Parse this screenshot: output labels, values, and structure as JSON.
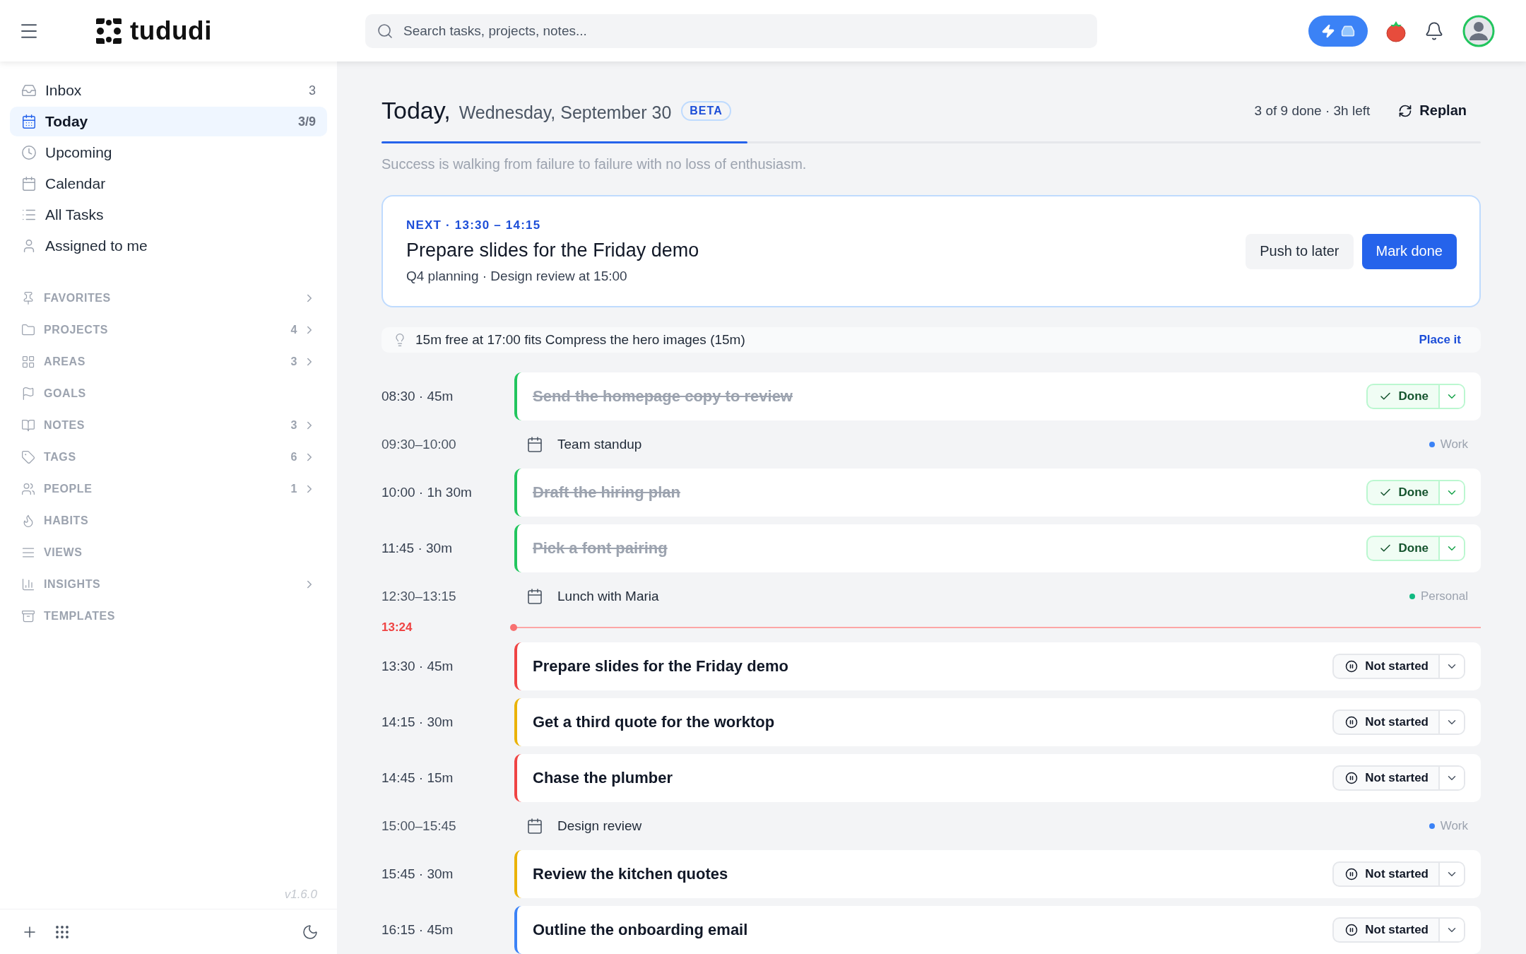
{
  "header": {
    "app_name": "tududi",
    "search": {
      "placeholder": "Search tasks, projects, notes..."
    }
  },
  "sidebar": {
    "nav": [
      {
        "label": "Inbox",
        "count": "3",
        "selected": false
      },
      {
        "label": "Today",
        "count": "3/9",
        "selected": true
      },
      {
        "label": "Upcoming",
        "selected": false
      },
      {
        "label": "Calendar",
        "selected": false
      },
      {
        "label": "All Tasks",
        "selected": false
      },
      {
        "label": "Assigned to me",
        "selected": false
      }
    ],
    "sections": [
      {
        "label": "FAVORITES",
        "expandable": true
      },
      {
        "label": "PROJECTS",
        "count": "4",
        "expandable": true
      },
      {
        "label": "AREAS",
        "count": "3",
        "expandable": true
      },
      {
        "label": "GOALS",
        "expandable": false
      },
      {
        "label": "NOTES",
        "count": "3",
        "expandable": true
      },
      {
        "label": "TAGS",
        "count": "6",
        "expandable": true
      },
      {
        "label": "PEOPLE",
        "count": "1",
        "expandable": true
      },
      {
        "label": "HABITS",
        "expandable": false
      },
      {
        "label": "VIEWS",
        "expandable": false
      },
      {
        "label": "INSIGHTS",
        "expandable": true
      },
      {
        "label": "TEMPLATES",
        "expandable": false
      }
    ],
    "version": "v1.6.0"
  },
  "page": {
    "title": "Today,",
    "date": "Wednesday, September 30",
    "badge": "BETA",
    "summary": "3 of 9 done · 3h left",
    "replan": "Replan",
    "progress": {
      "level": 0.333
    },
    "quote": "Success is walking from failure to failure with no loss of enthusiasm.",
    "next": {
      "eyebrow": "NEXT · 13:30 – 14:15",
      "title": "Prepare slides for the Friday demo",
      "meta": "Q4 planning · Design review at 15:00",
      "buttons": [
        {
          "label": "Push to later",
          "kind": "secondary"
        },
        {
          "label": "Mark done",
          "kind": "primary"
        }
      ]
    },
    "suggestion": {
      "text": "15m free at 17:00 fits Compress the hero images (15m)",
      "action": "Place it"
    },
    "timeline": [
      {
        "kind": "task",
        "time": "08:30 · 45m",
        "title": "Send the homepage copy to review",
        "color": "#22c55e",
        "done": true,
        "status": "Done"
      },
      {
        "kind": "event",
        "time": "09:30–10:00",
        "title": "Team standup",
        "tag": "Work",
        "color": "#3b82f6"
      },
      {
        "kind": "task",
        "time": "10:00 · 1h 30m",
        "title": "Draft the hiring plan",
        "color": "#22c55e",
        "done": true,
        "status": "Done"
      },
      {
        "kind": "task",
        "time": "11:45 · 30m",
        "title": "Pick a font pairing",
        "color": "#22c55e",
        "done": true,
        "status": "Done"
      },
      {
        "kind": "event",
        "time": "12:30–13:15",
        "title": "Lunch with Maria",
        "tag": "Personal",
        "color": "#10b981"
      },
      {
        "kind": "now",
        "time": "13:24"
      },
      {
        "kind": "task",
        "time": "13:30 · 45m",
        "title": "Prepare slides for the Friday demo",
        "color": "#ef4444",
        "done": false,
        "status": "Not started"
      },
      {
        "kind": "task",
        "time": "14:15 · 30m",
        "title": "Get a third quote for the worktop",
        "color": "#eab308",
        "done": false,
        "status": "Not started"
      },
      {
        "kind": "task",
        "time": "14:45 · 15m",
        "title": "Chase the plumber",
        "color": "#ef4444",
        "done": false,
        "status": "Not started"
      },
      {
        "kind": "event",
        "time": "15:00–15:45",
        "title": "Design review",
        "tag": "Work",
        "color": "#3b82f6"
      },
      {
        "kind": "task",
        "time": "15:45 · 30m",
        "title": "Review the kitchen quotes",
        "color": "#eab308",
        "done": false,
        "status": "Not started"
      },
      {
        "kind": "task",
        "time": "16:15 · 45m",
        "title": "Outline the onboarding email",
        "color": "#3b82f6",
        "done": false,
        "status": "Not started"
      }
    ]
  }
}
